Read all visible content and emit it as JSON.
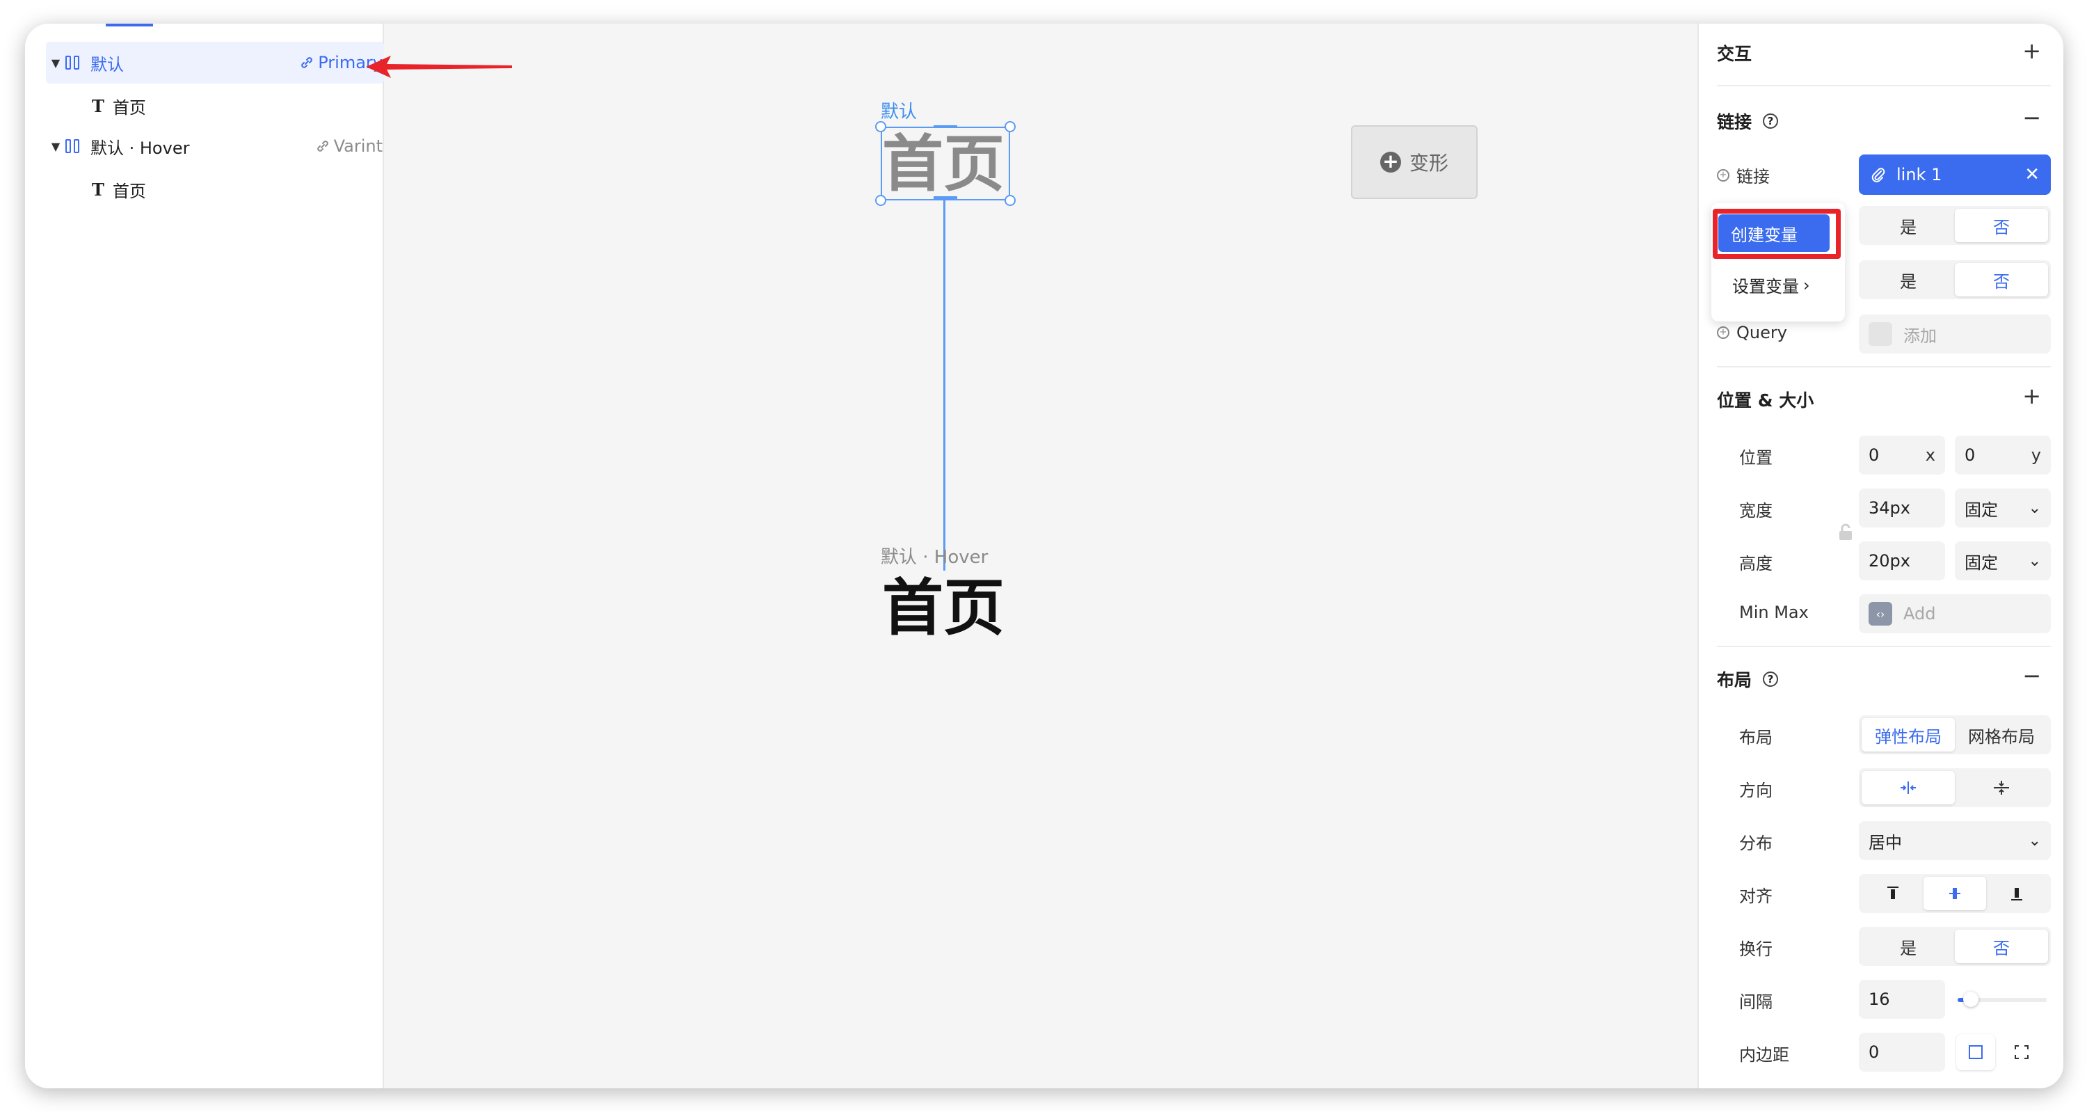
{
  "layers": [
    {
      "name": "默认",
      "tag": "Primary",
      "selected": true,
      "child": "首页"
    },
    {
      "name": "默认 · Hover",
      "tag": "Varint",
      "selected": false,
      "child": "首页"
    }
  ],
  "canvas": {
    "default_label": "默认",
    "default_text": "首页",
    "hover_label": "默认 · Hover",
    "hover_text": "首页",
    "transform_label": "变形"
  },
  "props": {
    "interaction": {
      "title": "交互",
      "action": "+"
    },
    "link": {
      "title": "链接",
      "action": "−",
      "link_label": "链接",
      "link_value": "link 1",
      "yes": "是",
      "no": "否",
      "query_label": "Query",
      "query_placeholder": "添加"
    },
    "popup": {
      "create": "创建变量",
      "set": "设置变量"
    },
    "position_size": {
      "title": "位置 & 大小",
      "action": "+",
      "position_label": "位置",
      "x_value": "0",
      "x_suffix": "x",
      "y_value": "0",
      "y_suffix": "y",
      "width_label": "宽度",
      "width_value": "34px",
      "width_mode": "固定",
      "height_label": "高度",
      "height_value": "20px",
      "height_mode": "固定",
      "minmax_label": "Min Max",
      "minmax_placeholder": "Add"
    },
    "layout": {
      "title": "布局",
      "action": "−",
      "layout_label": "布局",
      "flex": "弹性布局",
      "grid": "网格布局",
      "direction_label": "方向",
      "distribution_label": "分布",
      "distribution_value": "居中",
      "align_label": "对齐",
      "wrap_label": "换行",
      "wrap_yes": "是",
      "wrap_no": "否",
      "gap_label": "间隔",
      "gap_value": "16",
      "padding_label": "内边距",
      "padding_value": "0"
    }
  },
  "colors": {
    "accent": "#3b6cf0",
    "highlight": "#e8232a"
  }
}
